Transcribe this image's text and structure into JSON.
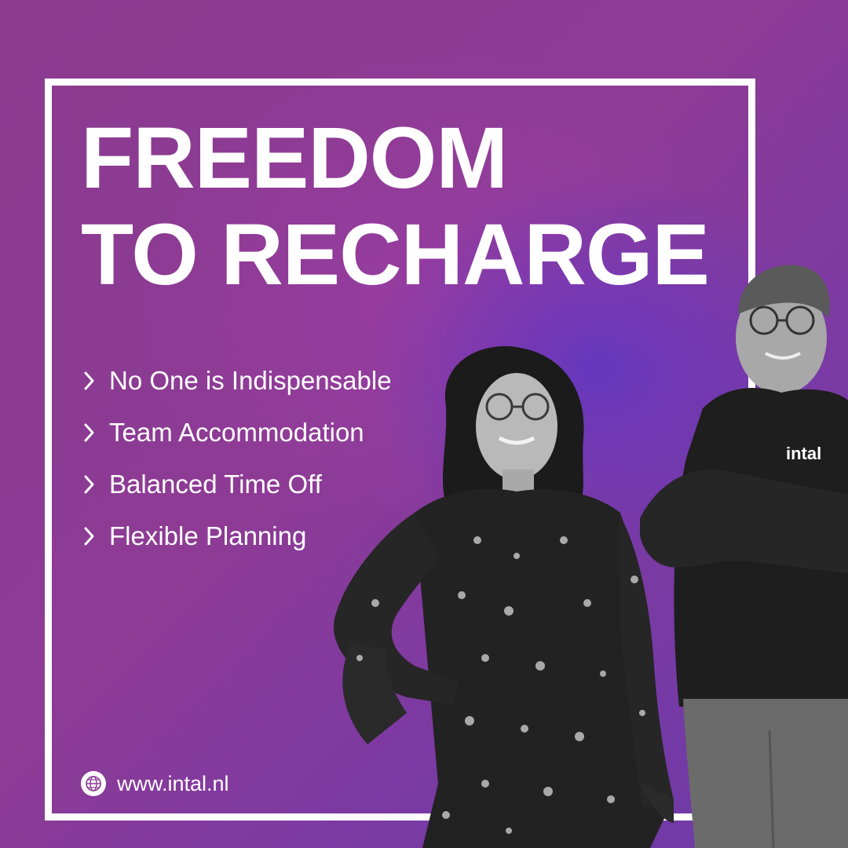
{
  "headline": {
    "line1": "FREEDOM",
    "line2": "TO RECHARGE"
  },
  "bullets": [
    {
      "text": "No One is Indispensable",
      "icon": "chevron-right-icon"
    },
    {
      "text": "Team Accommodation",
      "icon": "chevron-right-icon"
    },
    {
      "text": "Balanced Time Off",
      "icon": "chevron-right-icon"
    },
    {
      "text": "Flexible Planning",
      "icon": "chevron-right-icon"
    }
  ],
  "footer": {
    "url": "www.intal.nl",
    "icon": "globe-icon"
  },
  "colors": {
    "background": "#8a3a93",
    "accent_blue": "#6036c4",
    "frame": "#ffffff",
    "text": "#ffffff"
  }
}
